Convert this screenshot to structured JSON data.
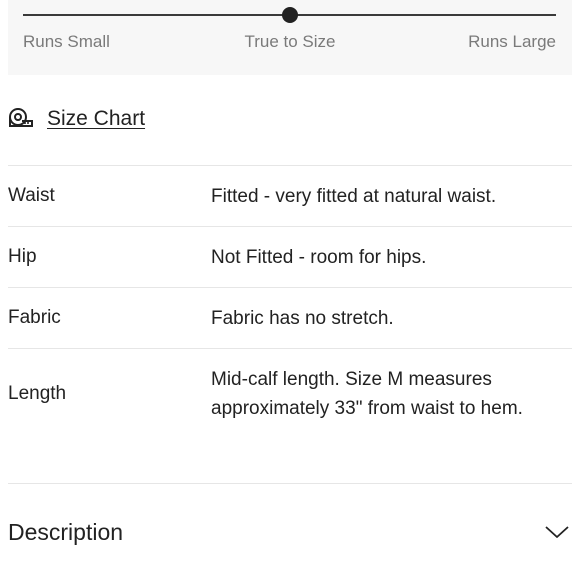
{
  "fit_scale": {
    "labels": [
      "Runs Small",
      "True to Size",
      "Runs Large"
    ],
    "selected_position": 0.5
  },
  "size_chart": {
    "icon": "measuring-tape-icon",
    "label": "Size Chart"
  },
  "fit_details": [
    {
      "attribute": "Waist",
      "value": "Fitted - very fitted at natural waist."
    },
    {
      "attribute": "Hip",
      "value": "Not Fitted - room for hips."
    },
    {
      "attribute": "Fabric",
      "value": "Fabric has no stretch."
    },
    {
      "attribute": "Length",
      "value": "Mid-calf length. Size M measures approximately 33\" from waist to hem."
    }
  ],
  "description": {
    "title": "Description",
    "icon": "chevron-down-icon"
  }
}
